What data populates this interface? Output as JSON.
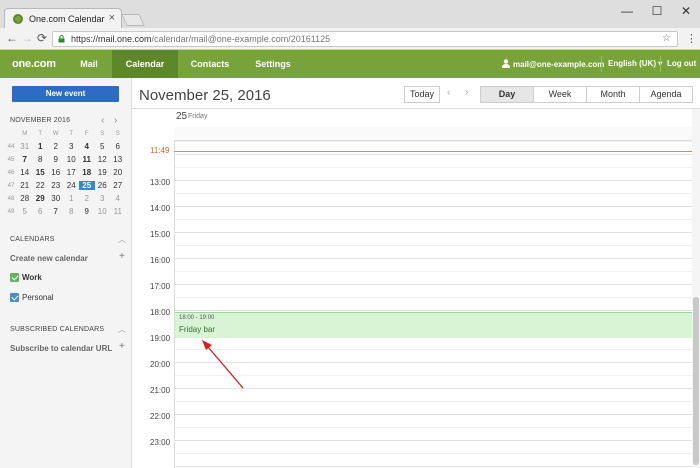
{
  "browser": {
    "tab_title": "One.com Calendar",
    "tab_close": "×",
    "url_host": "https://mail.one.com",
    "url_path": "/calendar/mail@one-example.com/20161125",
    "back": "←",
    "forward": "→",
    "reload": "⟳",
    "star": "☆",
    "menu": "⋮",
    "minimize": "—",
    "maximize": "☐",
    "close": "✕"
  },
  "nav": {
    "logo": "one.com",
    "items": [
      "Mail",
      "Calendar",
      "Contacts",
      "Settings"
    ],
    "user": "mail@one-example.com",
    "language": "English (UK) ▾",
    "logout": "Log out"
  },
  "sidebar": {
    "new_event": "New event",
    "mini_month": "NOVEMBER 2016",
    "prev": "‹",
    "next": "›",
    "weekday_headers": [
      "M",
      "T",
      "W",
      "T",
      "F",
      "S",
      "S"
    ],
    "weeks": [
      {
        "wk": "44",
        "days": [
          "31",
          "1",
          "2",
          "3",
          "4",
          "5",
          "6"
        ]
      },
      {
        "wk": "45",
        "days": [
          "7",
          "8",
          "9",
          "10",
          "11",
          "12",
          "13"
        ]
      },
      {
        "wk": "46",
        "days": [
          "14",
          "15",
          "16",
          "17",
          "18",
          "19",
          "20"
        ]
      },
      {
        "wk": "47",
        "days": [
          "21",
          "22",
          "23",
          "24",
          "25",
          "26",
          "27"
        ]
      },
      {
        "wk": "48",
        "days": [
          "28",
          "29",
          "30",
          "1",
          "2",
          "3",
          "4"
        ]
      },
      {
        "wk": "49",
        "days": [
          "5",
          "6",
          "7",
          "8",
          "9",
          "10",
          "11"
        ]
      }
    ],
    "calendars_title": "CALENDARS",
    "create_calendar": "Create new calendar",
    "calendars": [
      {
        "name": "Work",
        "color": "#5cb85c"
      },
      {
        "name": "Personal",
        "color": "#4a90c8"
      }
    ],
    "subscribed_title": "SUBSCRIBED CALENDARS",
    "subscribe_link": "Subscribe to calendar URL",
    "plus": "+",
    "chevron": "︿"
  },
  "main": {
    "date_title": "November 25, 2016",
    "today": "Today",
    "prev": "‹",
    "next": "›",
    "views": [
      "Day",
      "Week",
      "Month",
      "Agenda"
    ],
    "active_view": "Day",
    "day_number": "25",
    "day_name": "Friday",
    "now_time": "11:49",
    "hours": [
      "13:00",
      "14:00",
      "15:00",
      "16:00",
      "17:00",
      "18:00",
      "19:00",
      "20:00",
      "21:00",
      "22:00",
      "23:00"
    ],
    "event": {
      "time": "18:00 - 19:00",
      "title": "Friday bar"
    }
  },
  "colors": {
    "brand_green": "#78a33a",
    "active_nav": "#5d8729",
    "new_event_blue": "#2d6bc4",
    "today_blue": "#2d8bd8",
    "event_bg": "#d9f3d5",
    "now_line": "#d98b3a",
    "annotation_arrow": "#d62020"
  }
}
